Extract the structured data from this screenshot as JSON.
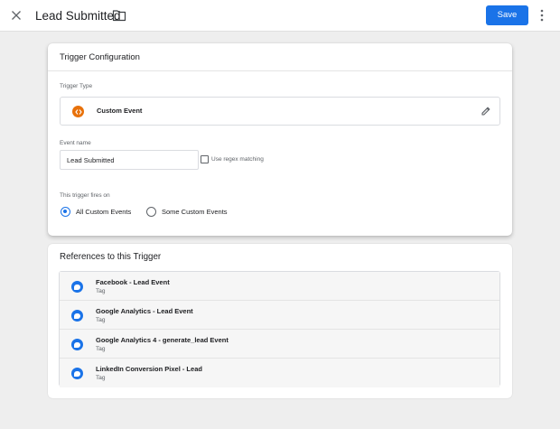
{
  "header": {
    "title": "Lead Submitted",
    "save_label": "Save",
    "close_icon": "close-icon",
    "folder_icon": "folder-icon",
    "more_icon": "more-vert-icon"
  },
  "trigger_config": {
    "heading": "Trigger Configuration",
    "type_label": "Trigger Type",
    "type_name": "Custom Event",
    "event_name_label": "Event name",
    "event_name_value": "Lead Submitted",
    "regex_label": "Use regex matching",
    "regex_checked": false,
    "fires_on_label": "This trigger fires on",
    "options": [
      {
        "label": "All Custom Events",
        "selected": true
      },
      {
        "label": "Some Custom Events",
        "selected": false
      }
    ]
  },
  "references": {
    "heading": "References to this Trigger",
    "items": [
      {
        "name": "Facebook - Lead Event",
        "type": "Tag"
      },
      {
        "name": "Google Analytics - Lead Event",
        "type": "Tag"
      },
      {
        "name": "Google Analytics 4 - generate_lead Event",
        "type": "Tag"
      },
      {
        "name": "LinkedIn Conversion Pixel - Lead",
        "type": "Tag"
      }
    ]
  },
  "colors": {
    "accent": "#1a73e8",
    "custom_event_icon": "#e8710a",
    "background": "#eeeeee"
  }
}
